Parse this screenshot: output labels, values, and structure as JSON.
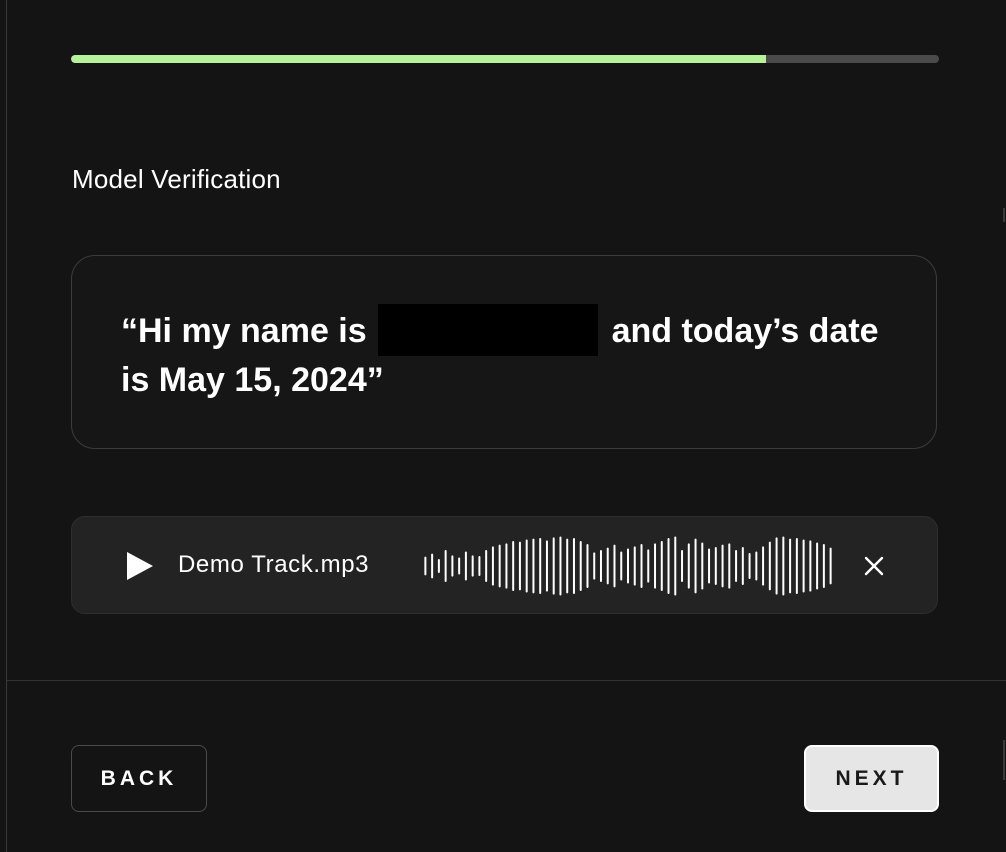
{
  "progress": {
    "fraction": 0.801
  },
  "section": {
    "title": "Model Verification"
  },
  "quote": {
    "prefix": "“Hi my name is",
    "suffix": "and today’s date is May 15, 2024”"
  },
  "audio": {
    "track_name": "Demo Track.mp3",
    "play_icon": "play-icon",
    "close_icon": "close-icon",
    "waveform_levels": [
      0.28,
      0.38,
      0.2,
      0.5,
      0.32,
      0.25,
      0.45,
      0.32,
      0.3,
      0.5,
      0.62,
      0.68,
      0.72,
      0.8,
      0.78,
      0.85,
      0.88,
      0.9,
      0.82,
      0.92,
      0.95,
      0.88,
      0.9,
      0.8,
      0.7,
      0.42,
      0.5,
      0.58,
      0.68,
      0.45,
      0.55,
      0.62,
      0.7,
      0.52,
      0.72,
      0.8,
      0.9,
      0.95,
      0.5,
      0.72,
      0.88,
      0.75,
      0.55,
      0.6,
      0.68,
      0.72,
      0.5,
      0.6,
      0.4,
      0.45,
      0.62,
      0.78,
      0.92,
      0.95,
      0.88,
      0.9,
      0.85,
      0.82,
      0.75,
      0.7,
      0.58
    ]
  },
  "buttons": {
    "back": "BACK",
    "next": "NEXT"
  },
  "colors": {
    "accent": "#b6f29a",
    "background": "#141414",
    "card": "#232323"
  }
}
